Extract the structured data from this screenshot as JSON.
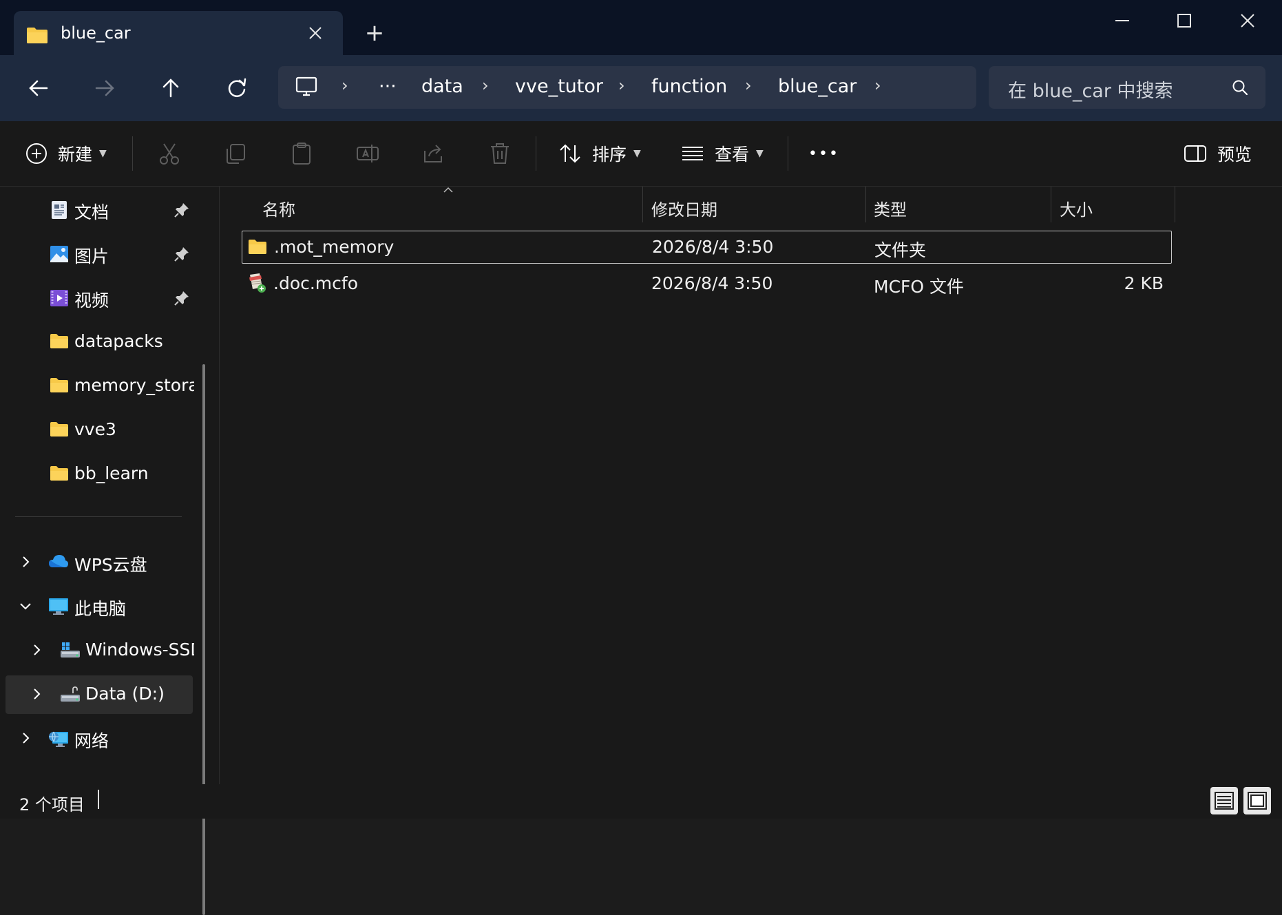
{
  "window": {
    "tab_title": "blue_car",
    "new_tab_symbol": "+"
  },
  "nav": {
    "breadcrumb": [
      "data",
      "vve_tutor",
      "function",
      "blue_car"
    ],
    "ellipsis": "···",
    "search_placeholder": "在 blue_car 中搜索"
  },
  "toolbar": {
    "new_label": "新建",
    "sort_label": "排序",
    "view_label": "查看",
    "more_label": "•••",
    "preview_label": "预览"
  },
  "sidebar": {
    "pinned": [
      {
        "label": "文档",
        "icon": "documents-icon"
      },
      {
        "label": "图片",
        "icon": "pictures-icon"
      },
      {
        "label": "视频",
        "icon": "videos-icon"
      }
    ],
    "folders": [
      {
        "label": "datapacks"
      },
      {
        "label": "memory_storag"
      },
      {
        "label": "vve3"
      },
      {
        "label": "bb_learn"
      }
    ],
    "tree": [
      {
        "label": "WPS云盘",
        "icon": "cloud-icon",
        "expanded": false
      },
      {
        "label": "此电脑",
        "icon": "computer-icon",
        "expanded": true
      },
      {
        "label": "Windows-SSD",
        "icon": "drive-icon",
        "expanded": false
      },
      {
        "label": "Data (D:)",
        "icon": "drive-icon",
        "expanded": false,
        "selected": true
      },
      {
        "label": "网络",
        "icon": "network-icon",
        "expanded": false
      }
    ]
  },
  "columns": {
    "name": "名称",
    "modified": "修改日期",
    "type": "类型",
    "size": "大小"
  },
  "files": [
    {
      "name": ".mot_memory",
      "modified": "2026/8/4 3:50",
      "type": "文件夹",
      "size": "",
      "icon": "folder-icon",
      "selected": true
    },
    {
      "name": ".doc.mcfo",
      "modified": "2026/8/4 3:50",
      "type": "MCFO 文件",
      "size": "2 KB",
      "icon": "mcfo-file-icon",
      "selected": false
    }
  ],
  "status": {
    "item_count": "2 个项目"
  },
  "colors": {
    "titlebar": "#0b1324",
    "navbar": "#1e2a3f",
    "background": "#191919",
    "folder": "#f7c948"
  }
}
